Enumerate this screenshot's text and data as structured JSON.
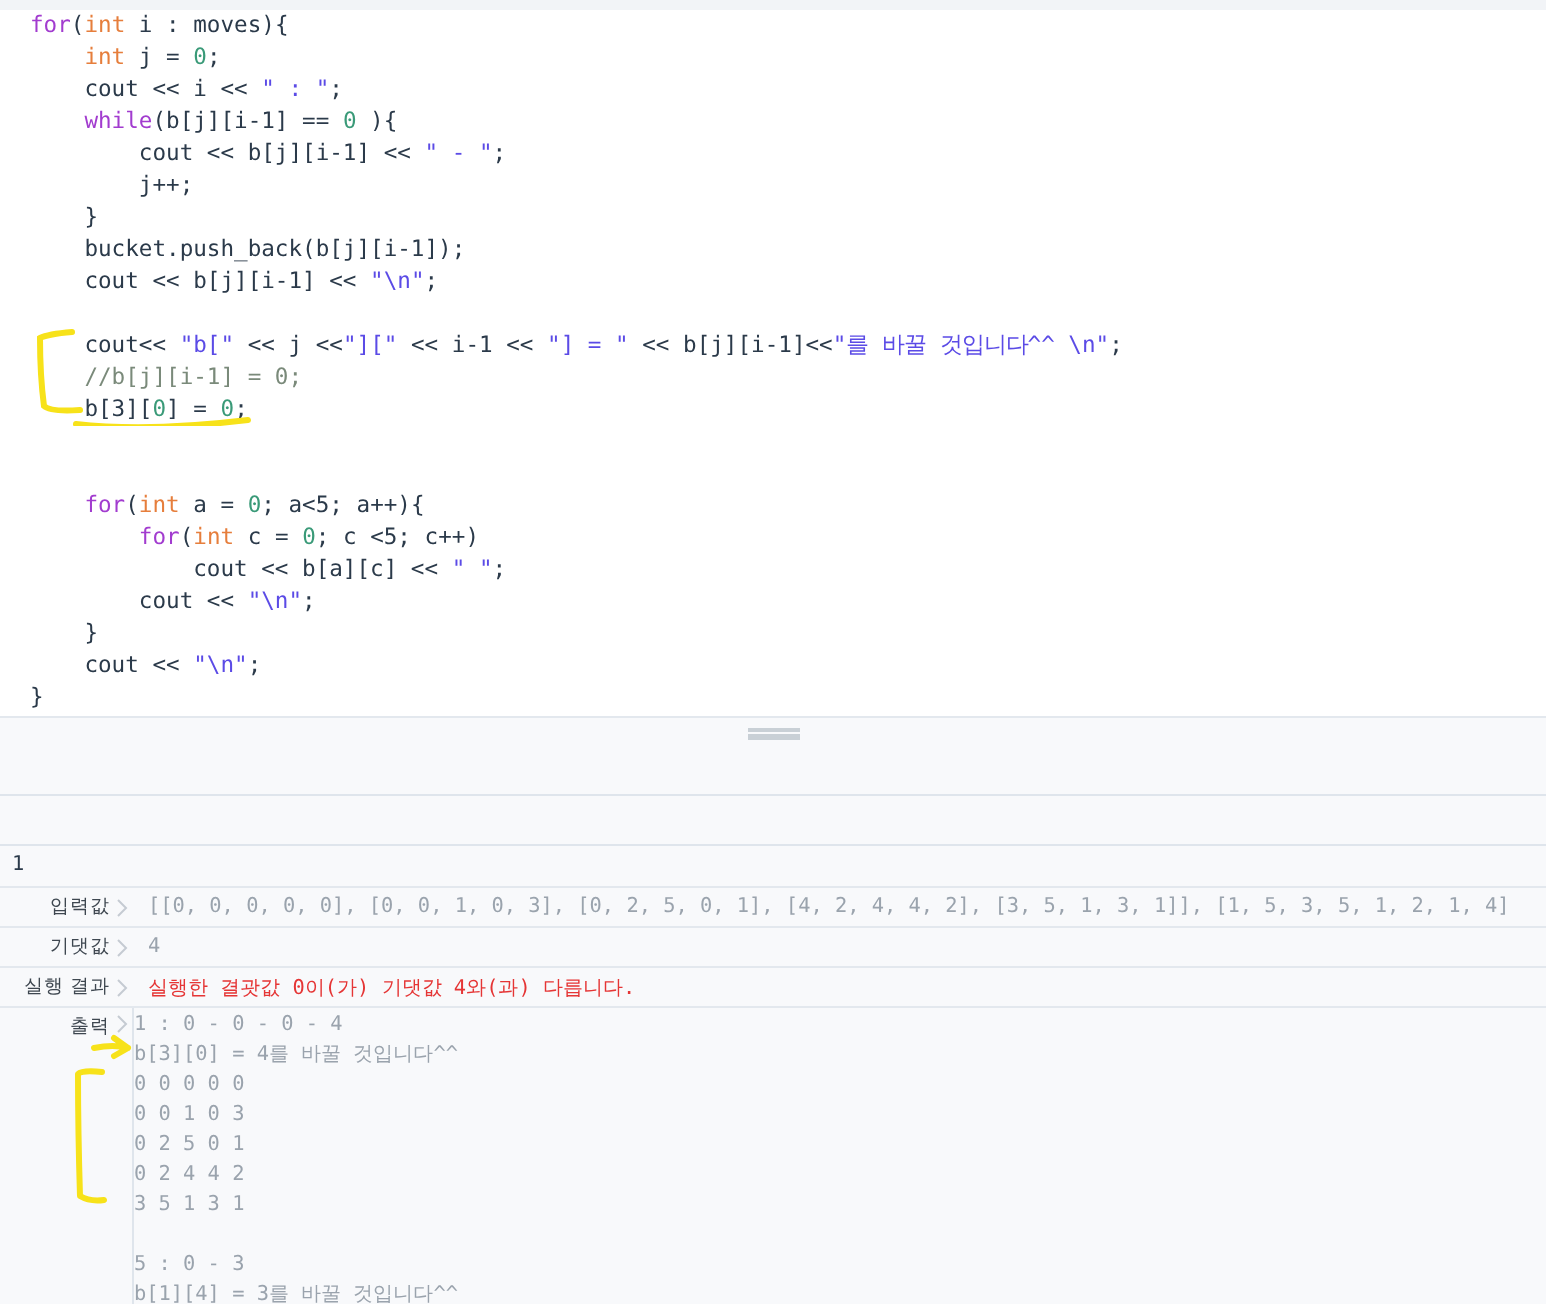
{
  "code_lines": [
    {
      "kind": "code",
      "tokens": [
        {
          "kind": "keyword",
          "text": "for"
        },
        {
          "kind": "plain",
          "text": "("
        },
        {
          "kind": "type",
          "text": "int"
        },
        {
          "kind": "plain",
          "text": " i : moves){"
        }
      ]
    },
    {
      "kind": "code",
      "tokens": [
        {
          "kind": "type",
          "text": "    int"
        },
        {
          "kind": "plain",
          "text": " j = "
        },
        {
          "kind": "number",
          "text": "0"
        },
        {
          "kind": "plain",
          "text": ";"
        }
      ]
    },
    {
      "kind": "code",
      "tokens": [
        {
          "kind": "plain",
          "text": "    cout << i << "
        },
        {
          "kind": "string",
          "text": "\" : \""
        },
        {
          "kind": "plain",
          "text": ";"
        }
      ]
    },
    {
      "kind": "code",
      "tokens": [
        {
          "kind": "keyword",
          "text": "    while"
        },
        {
          "kind": "plain",
          "text": "(b[j][i-1] == "
        },
        {
          "kind": "number",
          "text": "0"
        },
        {
          "kind": "plain",
          "text": " ){"
        }
      ]
    },
    {
      "kind": "code",
      "tokens": [
        {
          "kind": "plain",
          "text": "        cout << b[j][i-1] << "
        },
        {
          "kind": "string",
          "text": "\" - \""
        },
        {
          "kind": "plain",
          "text": ";"
        }
      ]
    },
    {
      "kind": "code",
      "tokens": [
        {
          "kind": "plain",
          "text": "        j++;"
        }
      ]
    },
    {
      "kind": "code",
      "tokens": [
        {
          "kind": "plain",
          "text": "    }"
        }
      ]
    },
    {
      "kind": "code",
      "tokens": [
        {
          "kind": "plain",
          "text": "    bucket.push_back(b[j][i-1]);"
        }
      ]
    },
    {
      "kind": "code",
      "tokens": [
        {
          "kind": "plain",
          "text": "    cout << b[j][i-1] << "
        },
        {
          "kind": "string",
          "text": "\"\\n\""
        },
        {
          "kind": "plain",
          "text": ";"
        }
      ]
    },
    {
      "kind": "blank"
    },
    {
      "kind": "code",
      "tokens": [
        {
          "kind": "plain",
          "text": "    cout<< "
        },
        {
          "kind": "string",
          "text": "\"b[\""
        },
        {
          "kind": "plain",
          "text": " << j <<"
        },
        {
          "kind": "string",
          "text": "\"][\""
        },
        {
          "kind": "plain",
          "text": " << i-1 << "
        },
        {
          "kind": "string",
          "text": "\"] = \""
        },
        {
          "kind": "plain",
          "text": " << b[j][i-1]<<"
        },
        {
          "kind": "string",
          "text": "\"를 바꿀 것입니다^^ \\n\""
        },
        {
          "kind": "plain",
          "text": ";"
        }
      ]
    },
    {
      "kind": "code",
      "tokens": [
        {
          "kind": "comment",
          "text": "    //b[j][i-1] = 0;"
        }
      ]
    },
    {
      "kind": "code",
      "tokens": [
        {
          "kind": "plain",
          "text": "    b[3]["
        },
        {
          "kind": "number",
          "text": "0"
        },
        {
          "kind": "plain",
          "text": "] = "
        },
        {
          "kind": "number",
          "text": "0"
        },
        {
          "kind": "plain",
          "text": ";"
        }
      ]
    },
    {
      "kind": "blank"
    },
    {
      "kind": "blank"
    },
    {
      "kind": "code",
      "tokens": [
        {
          "kind": "keyword",
          "text": "    for"
        },
        {
          "kind": "plain",
          "text": "("
        },
        {
          "kind": "type",
          "text": "int"
        },
        {
          "kind": "plain",
          "text": " a = "
        },
        {
          "kind": "number",
          "text": "0"
        },
        {
          "kind": "plain",
          "text": "; a<5; a++){"
        }
      ]
    },
    {
      "kind": "code",
      "tokens": [
        {
          "kind": "keyword",
          "text": "        for"
        },
        {
          "kind": "plain",
          "text": "("
        },
        {
          "kind": "type",
          "text": "int"
        },
        {
          "kind": "plain",
          "text": " c = "
        },
        {
          "kind": "number",
          "text": "0"
        },
        {
          "kind": "plain",
          "text": "; c <5; c++)"
        }
      ]
    },
    {
      "kind": "code",
      "tokens": [
        {
          "kind": "plain",
          "text": "            cout << b[a][c] << "
        },
        {
          "kind": "string",
          "text": "\" \""
        },
        {
          "kind": "plain",
          "text": ";"
        }
      ]
    },
    {
      "kind": "code",
      "tokens": [
        {
          "kind": "plain",
          "text": "        cout << "
        },
        {
          "kind": "string",
          "text": "\"\\n\""
        },
        {
          "kind": "plain",
          "text": ";"
        }
      ]
    },
    {
      "kind": "code",
      "tokens": [
        {
          "kind": "plain",
          "text": "    }"
        }
      ]
    },
    {
      "kind": "code",
      "tokens": [
        {
          "kind": "plain",
          "text": "    cout << "
        },
        {
          "kind": "string",
          "text": "\"\\n\""
        },
        {
          "kind": "plain",
          "text": ";"
        }
      ]
    },
    {
      "kind": "code",
      "tokens": [
        {
          "kind": "plain",
          "text": "}"
        }
      ]
    }
  ],
  "test_case": {
    "title": "1",
    "rows": [
      {
        "label": "입력값",
        "kind": "normal",
        "value": "[[0, 0, 0, 0, 0], [0, 0, 1, 0, 3], [0, 2, 5, 0, 1], [4, 2, 4, 4, 2], [3, 5, 1, 3, 1]], [1, 5, 3, 5, 1, 2, 1, 4]"
      },
      {
        "label": "기댓값",
        "kind": "normal",
        "value": "4"
      },
      {
        "label": "실행 결과",
        "kind": "error",
        "value": "실행한 결괏값 0이(가) 기댓값 4와(과) 다릅니다."
      }
    ],
    "output": {
      "label": "출력",
      "blocks": [
        {
          "lines": [
            "1 : 0 - 0 - 0 - 4",
            "b[3][0] = 4를 바꿀 것입니다^^",
            "0 0 0 0 0",
            "0 0 1 0 3",
            "0 2 5 0 1",
            "0 2 4 4 2",
            "3 5 1 3 1"
          ]
        },
        {
          "lines": [
            "5 : 0 - 3",
            "b[1][4] = 3를 바꿀 것입니다^^"
          ]
        }
      ]
    }
  }
}
